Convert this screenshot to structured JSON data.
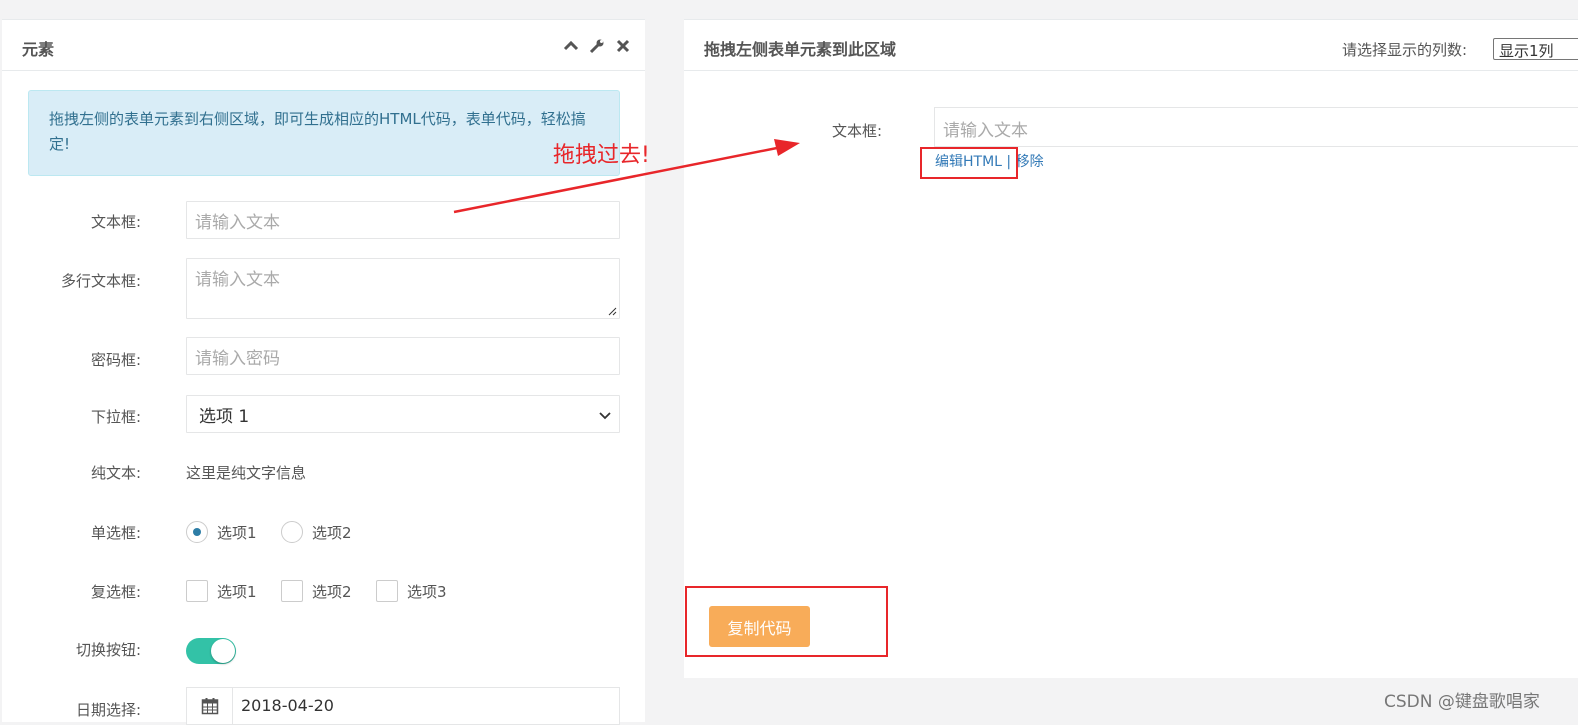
{
  "left_panel": {
    "title": "元素",
    "alert": "拖拽左侧的表单元素到右侧区域，即可生成相应的HTML代码，表单代码，轻松搞定!",
    "fields": {
      "text": {
        "label": "文本框:",
        "placeholder": "请输入文本"
      },
      "textarea": {
        "label": "多行文本框:",
        "placeholder": "请输入文本"
      },
      "password": {
        "label": "密码框:",
        "placeholder": "请输入密码"
      },
      "select": {
        "label": "下拉框:",
        "value": "选项 1"
      },
      "plain": {
        "label": "纯文本:",
        "value": "这里是纯文字信息"
      },
      "radio": {
        "label": "单选框:",
        "options": [
          "选项1",
          "选项2"
        ],
        "selected": "选项1"
      },
      "checkbox": {
        "label": "复选框:",
        "options": [
          "选项1",
          "选项2",
          "选项3"
        ]
      },
      "toggle": {
        "label": "切换按钮:"
      },
      "date": {
        "label": "日期选择:",
        "value": "2018-04-20"
      }
    }
  },
  "right_panel": {
    "title": "拖拽左侧表单元素到此区域",
    "columns_label": "请选择显示的列数:",
    "columns_value": "显示1列",
    "field_label": "文本框:",
    "field_placeholder": "请输入文本",
    "edit_link": "编辑HTML",
    "separator": "|",
    "remove_link": "移除",
    "copy_button": "复制代码"
  },
  "annotation": {
    "text": "拖拽过去!",
    "color": "#e8262a"
  },
  "watermark": "CSDN @键盘歌唱家",
  "colors": {
    "accent_teal": "#33c2a7",
    "copy_button": "#f8ac59",
    "link": "#337ab7",
    "alert_bg": "#d9edf7"
  }
}
